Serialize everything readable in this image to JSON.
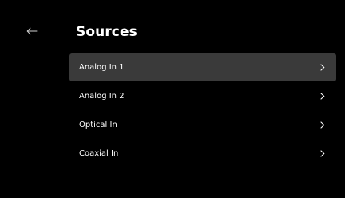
{
  "header": {
    "title": "Sources",
    "back_icon": "arrow-left-icon"
  },
  "sources": {
    "selected_index": 0,
    "items": [
      {
        "label": "Analog In 1",
        "icon": "chevron-right-icon"
      },
      {
        "label": "Analog In 2",
        "icon": "chevron-right-icon"
      },
      {
        "label": "Optical In",
        "icon": "chevron-right-icon"
      },
      {
        "label": "Coaxial In",
        "icon": "chevron-right-icon"
      }
    ]
  },
  "colors": {
    "background": "#000000",
    "selected_row": "#3a3a3a",
    "text": "#ffffff"
  }
}
